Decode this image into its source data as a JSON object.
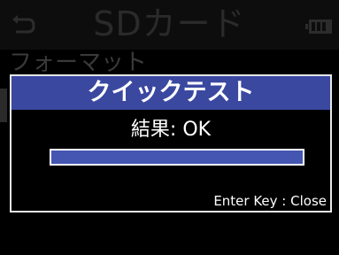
{
  "header": {
    "back_icon": "back-arrow-icon",
    "title": "SDカード",
    "battery_icon": "battery-icon"
  },
  "menu": {
    "items": [
      {
        "label": "フォーマット"
      }
    ]
  },
  "dialog": {
    "title": "クイックテスト",
    "result": "結果: OK",
    "progress": 1.0,
    "hint": "Enter Key : Close"
  },
  "colors": {
    "accent": "#3b48a0",
    "progress_fill": "#4456b2",
    "dimmed_text": "#2a2a2a"
  }
}
